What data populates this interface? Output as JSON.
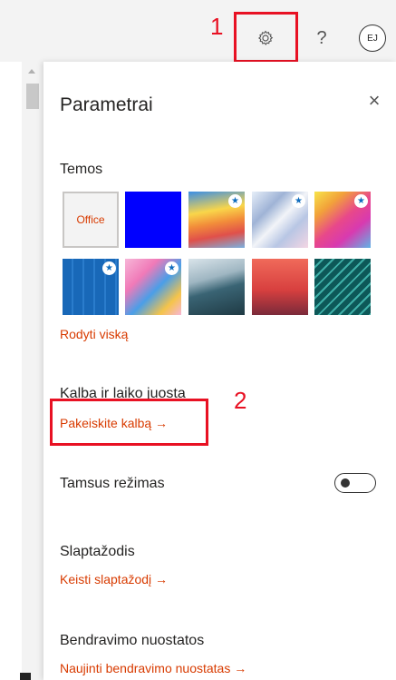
{
  "annotations": {
    "step1": "1",
    "step2": "2"
  },
  "top_bar": {
    "settings_icon": "gear-icon",
    "help_label": "?",
    "avatar_initials": "EJ"
  },
  "settings_panel": {
    "title": "Parametrai",
    "close_label": "×",
    "themes": {
      "label": "Temos",
      "office_label": "Office",
      "show_all_link": "Rodyti viską",
      "items": [
        {
          "name": "office",
          "color": "#ffffff"
        },
        {
          "name": "blue",
          "color": "#0000ff"
        },
        {
          "name": "rainbow",
          "color": "#f5a623"
        },
        {
          "name": "abstract-light",
          "color": "#c8d4e8"
        },
        {
          "name": "unicorn",
          "color": "#e84a8a"
        },
        {
          "name": "circuit-blue",
          "color": "#1868b8"
        },
        {
          "name": "pattern-pink",
          "color": "#f07ab8"
        },
        {
          "name": "mountain",
          "color": "#2f5f6f"
        },
        {
          "name": "palms",
          "color": "#d8403f"
        },
        {
          "name": "circuit-teal",
          "color": "#0d6a6a"
        }
      ]
    },
    "language_time": {
      "label": "Kalba ir laiko juosta",
      "link": "Pakeiskite kalbą →"
    },
    "dark_mode": {
      "label": "Tamsus režimas",
      "enabled": false
    },
    "password": {
      "label": "Slaptažodis",
      "link": "Keisti slaptažodį →"
    },
    "communication": {
      "label": "Bendravimo nuostatos",
      "link": "Naujinti bendravimo nuostatas →"
    }
  },
  "colors": {
    "accent": "#d83b01",
    "annotation": "#e81123"
  }
}
